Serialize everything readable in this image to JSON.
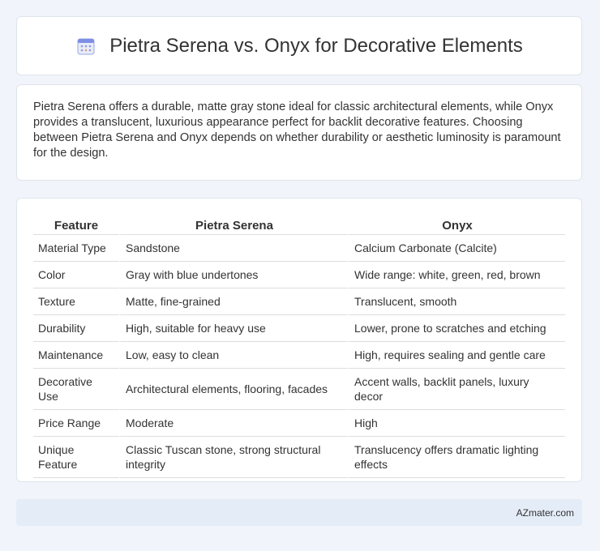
{
  "header": {
    "title": "Pietra Serena vs. Onyx for Decorative Elements",
    "icon": "calendar-icon"
  },
  "intro": {
    "text": "Pietra Serena offers a durable, matte gray stone ideal for classic architectural elements, while Onyx provides a translucent, luxurious appearance perfect for backlit decorative features. Choosing between Pietra Serena and Onyx depends on whether durability or aesthetic luminosity is paramount for the design."
  },
  "table": {
    "headers": [
      "Feature",
      "Pietra Serena",
      "Onyx"
    ],
    "rows": [
      [
        "Material Type",
        "Sandstone",
        "Calcium Carbonate (Calcite)"
      ],
      [
        "Color",
        "Gray with blue undertones",
        "Wide range: white, green, red, brown"
      ],
      [
        "Texture",
        "Matte, fine-grained",
        "Translucent, smooth"
      ],
      [
        "Durability",
        "High, suitable for heavy use",
        "Lower, prone to scratches and etching"
      ],
      [
        "Maintenance",
        "Low, easy to clean",
        "High, requires sealing and gentle care"
      ],
      [
        "Decorative Use",
        "Architectural elements, flooring, facades",
        "Accent walls, backlit panels, luxury decor"
      ],
      [
        "Price Range",
        "Moderate",
        "High"
      ],
      [
        "Unique Feature",
        "Classic Tuscan stone, strong structural integrity",
        "Translucency offers dramatic lighting effects"
      ]
    ]
  },
  "footer": {
    "brand": "AZmater.com"
  }
}
